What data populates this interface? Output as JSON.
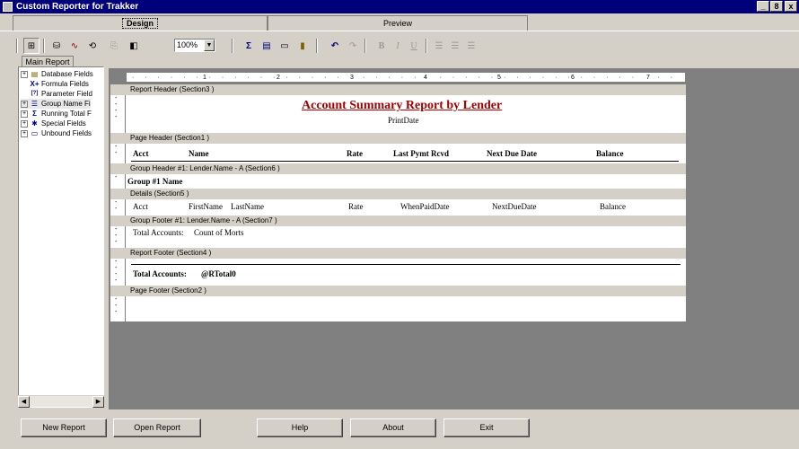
{
  "window": {
    "title": "Custom Reporter for Trakker",
    "controls": [
      "_",
      "8",
      "x"
    ]
  },
  "tabs": [
    "Design",
    "Preview"
  ],
  "toolbar": {
    "zoom_value": "100%",
    "icons": [
      "select-icon",
      "database-icon",
      "chart-icon",
      "link-icon",
      "group-icon",
      "properties-icon",
      "sum-icon",
      "text-field-icon",
      "box-icon",
      "picture-icon",
      "undo-icon",
      "redo-icon",
      "bold-icon",
      "italic-icon",
      "underline-icon",
      "align-left-icon",
      "align-center-icon",
      "align-right-icon"
    ],
    "labels": {
      "sum": "Σ",
      "bold": "B",
      "italic": "I",
      "underline": "U"
    }
  },
  "tree": {
    "tab_label": "Main Report",
    "items": [
      {
        "label": "Database Fields",
        "expand": "+",
        "icon": "▤"
      },
      {
        "label": "Formula Fields",
        "expand": "",
        "icon": "X+"
      },
      {
        "label": "Parameter Field",
        "expand": "",
        "icon": "[?]"
      },
      {
        "label": "Group Name Fi",
        "expand": "+",
        "icon": "☰"
      },
      {
        "label": "Running Total F",
        "expand": "+",
        "icon": "Σ"
      },
      {
        "label": "Special Fields",
        "expand": "+",
        "icon": "✱"
      },
      {
        "label": "Unbound Fields",
        "expand": "+",
        "icon": "▭"
      }
    ]
  },
  "ruler": {
    "marks": [
      "1",
      "2",
      "3",
      "4",
      "5",
      "6",
      "7"
    ]
  },
  "sections": [
    {
      "header": "Report Header  (Section3 )"
    },
    {
      "header": "Page Header  (Section1 )"
    },
    {
      "header": "Group Header #1: Lender.Name - A (Section6 )"
    },
    {
      "header": "Details  (Section5 )"
    },
    {
      "header": "Group Footer #1: Lender.Name - A (Section7 )"
    },
    {
      "header": "Report Footer  (Section4 )"
    },
    {
      "header": "Page Footer  (Section2 )"
    }
  ],
  "report": {
    "title": "Account Summary Report  by Lender",
    "print_date": "PrintDate",
    "page_header_cols": [
      "Acct",
      "Name",
      "Rate",
      "Last Pymt Rcvd",
      "Next Due Date",
      "Balance"
    ],
    "group_header": "Group #1 Name",
    "detail_fields": [
      "Acct",
      "FirstName",
      "LastName",
      "Rate",
      "WhenPaidDate",
      "NextDueDate",
      "Balance"
    ],
    "group_footer_label": "Total Accounts:",
    "group_footer_value": "Count of Morts",
    "report_footer_label": "Total Accounts:",
    "report_footer_value": "@RTotal0"
  },
  "buttons": [
    "New Report",
    "Open Report",
    "Help",
    "About",
    "Exit"
  ]
}
